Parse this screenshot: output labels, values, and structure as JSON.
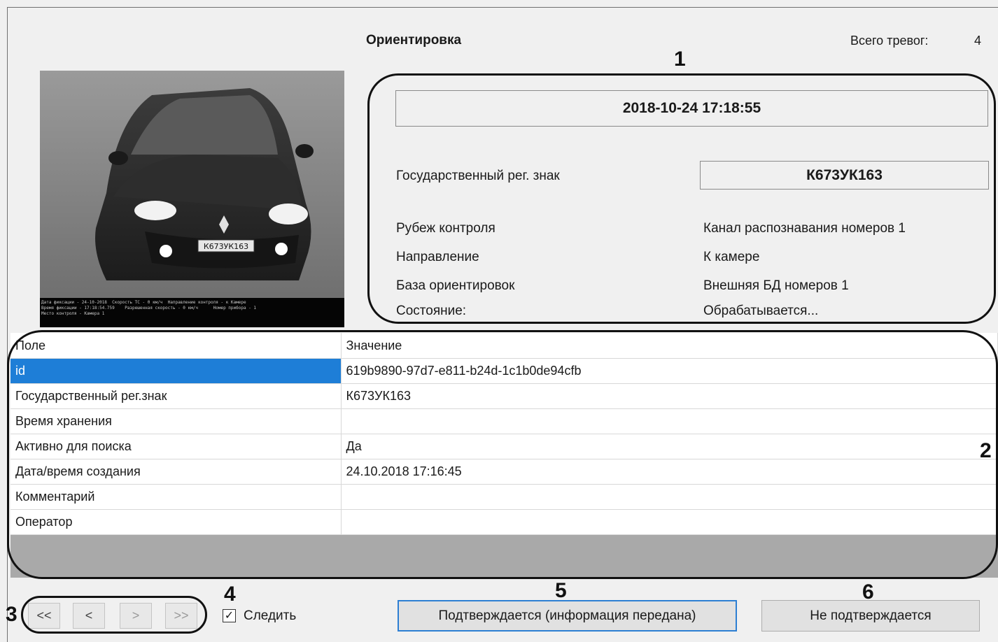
{
  "header": {
    "title": "Ориентировка",
    "alarm_label": "Всего тревог:",
    "alarm_count": "4"
  },
  "photo": {
    "plate_text": "К673УК163",
    "caption_lines": [
      "Дата фиксации - 24-10-2018  Скорость ТС - 0 км/ч  Направление контроля - к Камере",
      "Время фиксации - 17:18:54.759    Разрешенная скорость - 0 км/ч      Номер прибора - 1",
      "Место контроля - Камера 1"
    ]
  },
  "info": {
    "datetime": "2018-10-24 17:18:55",
    "plate_label": "Государственный рег. знак",
    "plate_value": "К673УК163",
    "rows": [
      {
        "label": "Рубеж контроля",
        "value": "Канал распознавания номеров 1"
      },
      {
        "label": "Направление",
        "value": "К камере"
      },
      {
        "label": "База ориентировок",
        "value": "Внешняя БД номеров 1"
      },
      {
        "label": "Состояние:",
        "value": "Обрабатывается..."
      }
    ]
  },
  "table": {
    "headers": [
      "Поле",
      "Значение"
    ],
    "rows": [
      {
        "field": "id",
        "value": "619b9890-97d7-e811-b24d-1c1b0de94cfb"
      },
      {
        "field": "Государственный рег.знак",
        "value": "К673УК163"
      },
      {
        "field": "Время хранения",
        "value": ""
      },
      {
        "field": "Активно для поиска",
        "value": "Да"
      },
      {
        "field": "Дата/время создания",
        "value": "24.10.2018 17:16:45"
      },
      {
        "field": "Комментарий",
        "value": ""
      },
      {
        "field": "Оператор",
        "value": ""
      }
    ]
  },
  "nav": {
    "first": "<<",
    "prev": "<",
    "next": ">",
    "last": ">>"
  },
  "follow": {
    "label": "Следить",
    "checked": true,
    "check_mark": "✓"
  },
  "buttons": {
    "confirm": "Подтверждается (информация передана)",
    "reject": "Не подтверждается"
  },
  "callouts": [
    "1",
    "2",
    "3",
    "4",
    "5",
    "6"
  ]
}
